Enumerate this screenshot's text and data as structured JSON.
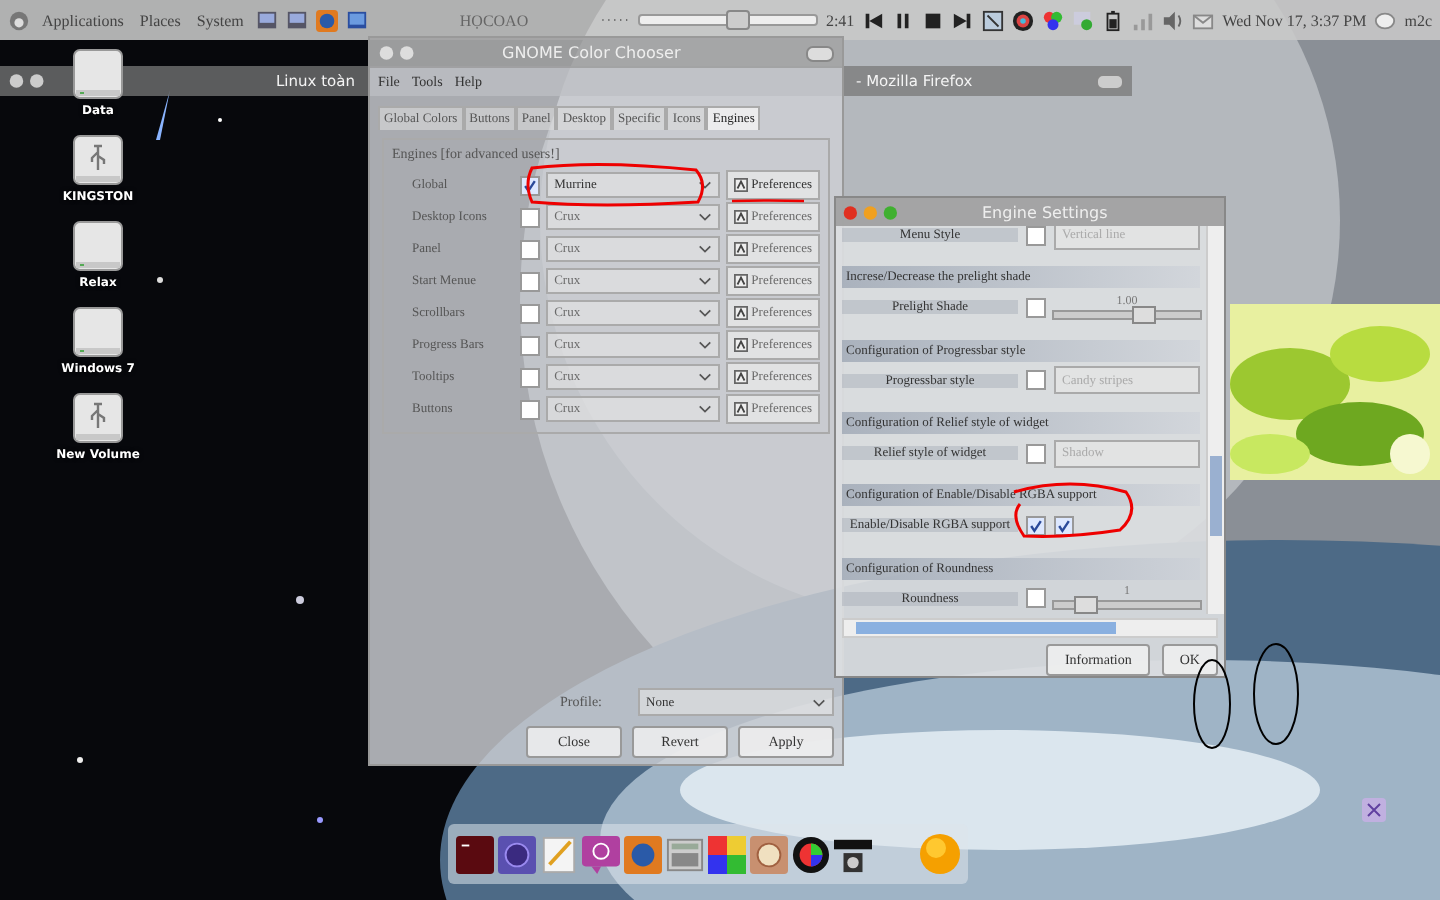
{
  "top_panel": {
    "menus": [
      "Applications",
      "Places",
      "System"
    ],
    "center_label": "HỌCOAO",
    "media": {
      "time": "2:41",
      "level": 0.55
    },
    "clock": "Wed Nov 17,  3:37 PM",
    "user": "m2c"
  },
  "desktop_icons": [
    {
      "label": "Data",
      "kind": "drive"
    },
    {
      "label": "KINGSTON",
      "kind": "usb"
    },
    {
      "label": "Relax",
      "kind": "drive"
    },
    {
      "label": "Windows 7",
      "kind": "drive"
    },
    {
      "label": "New Volume",
      "kind": "usb"
    }
  ],
  "firefox_window": {
    "title_parts": [
      "Linux toàn",
      "- Mozilla Firefox"
    ]
  },
  "color_chooser": {
    "title": "GNOME Color Chooser",
    "menu": [
      "File",
      "Tools",
      "Help"
    ],
    "tabs": [
      {
        "label": "Global Colors",
        "selected": false
      },
      {
        "label": "Buttons",
        "selected": false
      },
      {
        "label": "Panel",
        "selected": false
      },
      {
        "label": "Desktop",
        "selected": false
      },
      {
        "label": "Specific",
        "selected": false
      },
      {
        "label": "Icons",
        "selected": false
      },
      {
        "label": "Engines",
        "selected": true
      }
    ],
    "group_title": "Engines [for advanced users!]",
    "engines": [
      {
        "label": "Global",
        "checked": true,
        "value": "Murrine",
        "button": "Preferences"
      },
      {
        "label": "Desktop Icons",
        "checked": false,
        "value": "Crux",
        "button": "Preferences"
      },
      {
        "label": "Panel",
        "checked": false,
        "value": "Crux",
        "button": "Preferences"
      },
      {
        "label": "Start Menue",
        "checked": false,
        "value": "Crux",
        "button": "Preferences"
      },
      {
        "label": "Scrollbars",
        "checked": false,
        "value": "Crux",
        "button": "Preferences"
      },
      {
        "label": "Progress Bars",
        "checked": false,
        "value": "Crux",
        "button": "Preferences"
      },
      {
        "label": "Tooltips",
        "checked": false,
        "value": "Crux",
        "button": "Preferences"
      },
      {
        "label": "Buttons",
        "checked": false,
        "value": "Crux",
        "button": "Preferences"
      }
    ],
    "profile_label": "Profile:",
    "profile_value": "None",
    "buttons": [
      "Close",
      "Revert",
      "Apply"
    ]
  },
  "engine_settings": {
    "title": "Engine Settings",
    "rows": [
      {
        "kind": "combo",
        "label": "Menu Style",
        "checked": false,
        "value": "Vertical line"
      },
      {
        "kind": "section",
        "label": "Increse/Decrease the prelight shade"
      },
      {
        "kind": "slider",
        "label": "Prelight Shade",
        "checked": false,
        "reading": "1.00",
        "level": 0.6
      },
      {
        "kind": "section",
        "label": "Configuration of Progressbar style"
      },
      {
        "kind": "combo",
        "label": "Progressbar style",
        "checked": false,
        "value": "Candy stripes"
      },
      {
        "kind": "section",
        "label": "Configuration of Relief style of widget"
      },
      {
        "kind": "combo",
        "label": "Relief style of widget",
        "checked": false,
        "value": "Shadow"
      },
      {
        "kind": "section",
        "label": "Configuration of Enable/Disable RGBA support"
      },
      {
        "kind": "toggle",
        "label": "Enable/Disable RGBA support",
        "checked": true,
        "enabled": true
      },
      {
        "kind": "section",
        "label": "Configuration of Roundness"
      },
      {
        "kind": "slider",
        "label": "Roundness",
        "checked": false,
        "reading": "1",
        "level": 0.2
      }
    ],
    "buttons": [
      "Information",
      "OK"
    ]
  }
}
